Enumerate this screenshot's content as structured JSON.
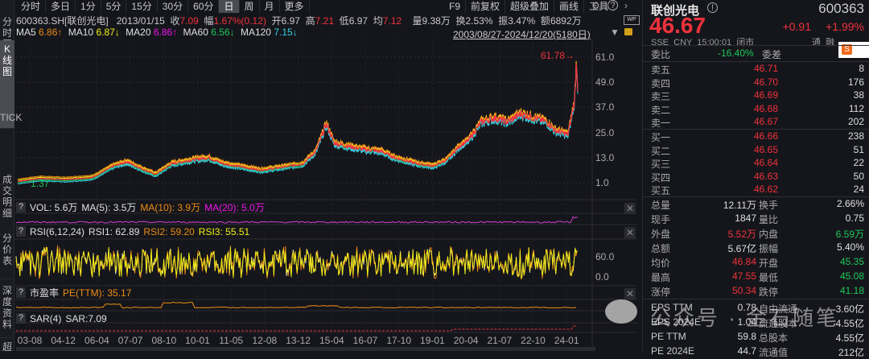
{
  "sidebar": [
    "分时图",
    "K线图",
    "TICK",
    "成交明细",
    "分价表",
    "深度资料",
    "超"
  ],
  "toolbar": {
    "tabs": [
      "分时",
      "多日",
      "1分",
      "5分",
      "15分",
      "30分",
      "60分",
      "日",
      "周",
      "月",
      "更多"
    ],
    "active": "日",
    "right": [
      "F9",
      "前复权",
      "超级叠加",
      "画线",
      "工具"
    ]
  },
  "info": {
    "code": "600363.SH[联创光电]",
    "date": "2013/01/15",
    "close_l": "收",
    "close": "7.09",
    "chg_l": "幅",
    "chg": "1.67%(0.12)",
    "open_l": "开",
    "open": "6.97",
    "high_l": "高",
    "high": "7.21",
    "low_l": "低",
    "low": "6.97",
    "avg_l": "均",
    "avg": "7.12",
    "vol_l": "量",
    "vol": "9.38万",
    "turn_l": "换",
    "turn": "2.53%",
    "amp_l": "振",
    "amp": "3.47%",
    "amt_l": "额",
    "amt": "6892万"
  },
  "ma": [
    {
      "l": "MA5",
      "v": "6.86↑",
      "c": "org"
    },
    {
      "l": "MA10",
      "v": "6.87↓",
      "c": "yel"
    },
    {
      "l": "MA20",
      "v": "6.86↑",
      "c": "mag"
    },
    {
      "l": "MA60",
      "v": "6.56↓",
      "c": "green"
    },
    {
      "l": "MA120",
      "v": "7.15↓",
      "c": "cyn"
    }
  ],
  "range": "2003/08/27-2024/12/20(5180日)",
  "main": {
    "max_label": "61.78→",
    "min_label": "1.37",
    "yticks": [
      "61.0",
      "49.0",
      "37.0",
      "25.0",
      "13.0",
      "1.0"
    ]
  },
  "vol": {
    "label": "VOL: 5.6万",
    "ma5": "MA(5): 3.5万",
    "ma10": "MA(10): 3.9万",
    "ma20": "MA(20): 5.0万"
  },
  "rsi": {
    "label": "RSI(6,12,24)",
    "rsi1": "RSI1: 62.89",
    "rsi2": "RSI2: 59.20",
    "rsi3": "RSI3: 55.51",
    "yticks": [
      "60.0",
      "0.0"
    ]
  },
  "pe": {
    "label": "市盈率",
    "value": "PE(TTM): 35.17"
  },
  "sar": {
    "label": "SAR(4)",
    "value": "SAR:7.09"
  },
  "xticks": [
    "03-08",
    "04-12",
    "06-04",
    "07-07",
    "08-10",
    "10-01",
    "11-05",
    "12-08",
    "13-12",
    "15-04",
    "16-07",
    "17-10",
    "19-01",
    "20-04",
    "21-07",
    "22-10",
    "24-01"
  ],
  "quote": {
    "name": "联创光电",
    "code": "600363",
    "price": "46.67",
    "change": "+0.91",
    "pct": "+1.99%",
    "meta": "SSE  CNY  15:00:01  闭市",
    "tags": "通  融",
    "ratio_l": "委比",
    "ratio": "-16.40%",
    "diff_l": "委差",
    "asks": [
      {
        "l": "卖五",
        "p": "46.71",
        "v": "8"
      },
      {
        "l": "卖四",
        "p": "46.70",
        "v": "176"
      },
      {
        "l": "卖三",
        "p": "46.69",
        "v": "38"
      },
      {
        "l": "卖二",
        "p": "46.68",
        "v": "112"
      },
      {
        "l": "卖一",
        "p": "46.67",
        "v": "202"
      }
    ],
    "bids": [
      {
        "l": "买一",
        "p": "46.66",
        "v": "238"
      },
      {
        "l": "买二",
        "p": "46.65",
        "v": "51"
      },
      {
        "l": "买三",
        "p": "46.64",
        "v": "22"
      },
      {
        "l": "买四",
        "p": "46.63",
        "v": "50"
      },
      {
        "l": "买五",
        "p": "46.62",
        "v": "24"
      }
    ],
    "stats": [
      [
        "总量",
        "12.11万",
        "wht",
        "换手",
        "2.66%",
        "wht"
      ],
      [
        "现手",
        "1847",
        "wht",
        "量比",
        "0.75",
        "wht"
      ],
      [
        "外盘",
        "5.52万",
        "red",
        "内盘",
        "6.59万",
        "green"
      ],
      [
        "总额",
        "5.67亿",
        "wht",
        "振幅",
        "5.40%",
        "wht"
      ],
      [
        "均价",
        "46.84",
        "red",
        "开盘",
        "45.35",
        "green"
      ],
      [
        "最高",
        "47.55",
        "red",
        "最低",
        "45.08",
        "green"
      ],
      [
        "涨停",
        "50.34",
        "red",
        "跌停",
        "41.18",
        "green"
      ]
    ],
    "fund": [
      [
        "EPS TTM",
        "0.78",
        "自由流通",
        "3.60亿"
      ],
      [
        "EPS 2024E",
        "1.04",
        "流通股本",
        "4.55亿"
      ],
      [
        "PE TTM",
        "59.8",
        "总股本",
        "4.55亿"
      ],
      [
        "PE 2024E",
        "44.7",
        "流通值",
        "212亿"
      ]
    ]
  },
  "watermark": "公众号 · 金石随笔",
  "colors": {
    "up": "#f0323c",
    "down": "#1ec85a",
    "bg": "#15161b"
  },
  "chart_data": {
    "type": "line",
    "title": "600363.SH 日K (前复权) approx close",
    "x": [
      2003.65,
      2004.5,
      2005.5,
      2006.5,
      2007.3,
      2007.8,
      2008.5,
      2008.9,
      2009.5,
      2010.3,
      2010.9,
      2011.5,
      2012.0,
      2012.9,
      2013.5,
      2014.5,
      2015.0,
      2015.4,
      2015.7,
      2016.0,
      2016.8,
      2017.5,
      2018.0,
      2018.9,
      2019.5,
      2020.0,
      2020.5,
      2020.8,
      2021.3,
      2021.8,
      2022.3,
      2022.8,
      2023.3,
      2023.8,
      2024.1,
      2024.6,
      2024.85,
      2024.92,
      2024.97
    ],
    "values": [
      1.6,
      3,
      2.5,
      3.5,
      9,
      11,
      7,
      5,
      10,
      12,
      13,
      10,
      9,
      7,
      8,
      10,
      16,
      29,
      20,
      19,
      17,
      16,
      13,
      10,
      9,
      12,
      19,
      21,
      30,
      32,
      30,
      34,
      32,
      30,
      26,
      24,
      40,
      60,
      46.67
    ],
    "ylim": [
      1,
      61
    ]
  }
}
